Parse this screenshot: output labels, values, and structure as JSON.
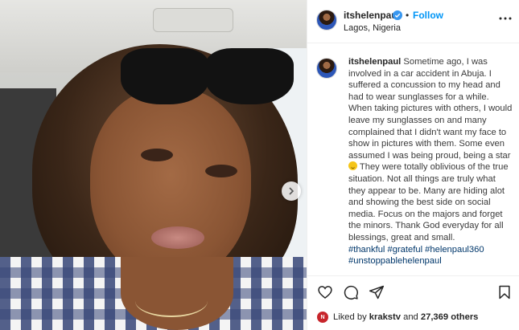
{
  "post": {
    "username": "itshelenpaul",
    "dot": "•",
    "follow_label": "Follow",
    "location": "Lagos, Nigeria",
    "caption": {
      "username": "itshelenpaul",
      "text_part1": " Sometime ago, I was involved in a car accident in Abuja. I suffered a concussion to my head and had to wear sunglasses for a while. When taking pictures with others, I would leave my sunglasses on and many complained that I didn't want my face to show in pictures with them. Some even assumed I was being proud, being a star ",
      "emoji": "grinning-face-emoji",
      "text_part2": " They were totally oblivious of the true situation. Not all things are truly what they appear to be. Many are hiding alot and showing the best side on social media. Focus on the majors and forget the minors. Thank God everyday for all blessings, great and small.",
      "hashtags": [
        "#thankful",
        "#grateful",
        "#helenpaul360",
        "#unstoppablehelenpaul"
      ]
    },
    "likes": {
      "badge": "N",
      "prefix": "Liked by ",
      "user": "krakstv",
      "middle": " and ",
      "count": "27,369 others"
    }
  },
  "colors": {
    "follow": "#0095f6",
    "hashtag": "#00376b",
    "verified": "#3897f0",
    "border": "#efefef"
  },
  "icons": {
    "header": [
      "verified-badge-icon",
      "more-options-icon"
    ],
    "actions": [
      "heart-icon",
      "comment-icon",
      "share-icon",
      "bookmark-icon"
    ],
    "carousel": "chevron-right-icon"
  }
}
